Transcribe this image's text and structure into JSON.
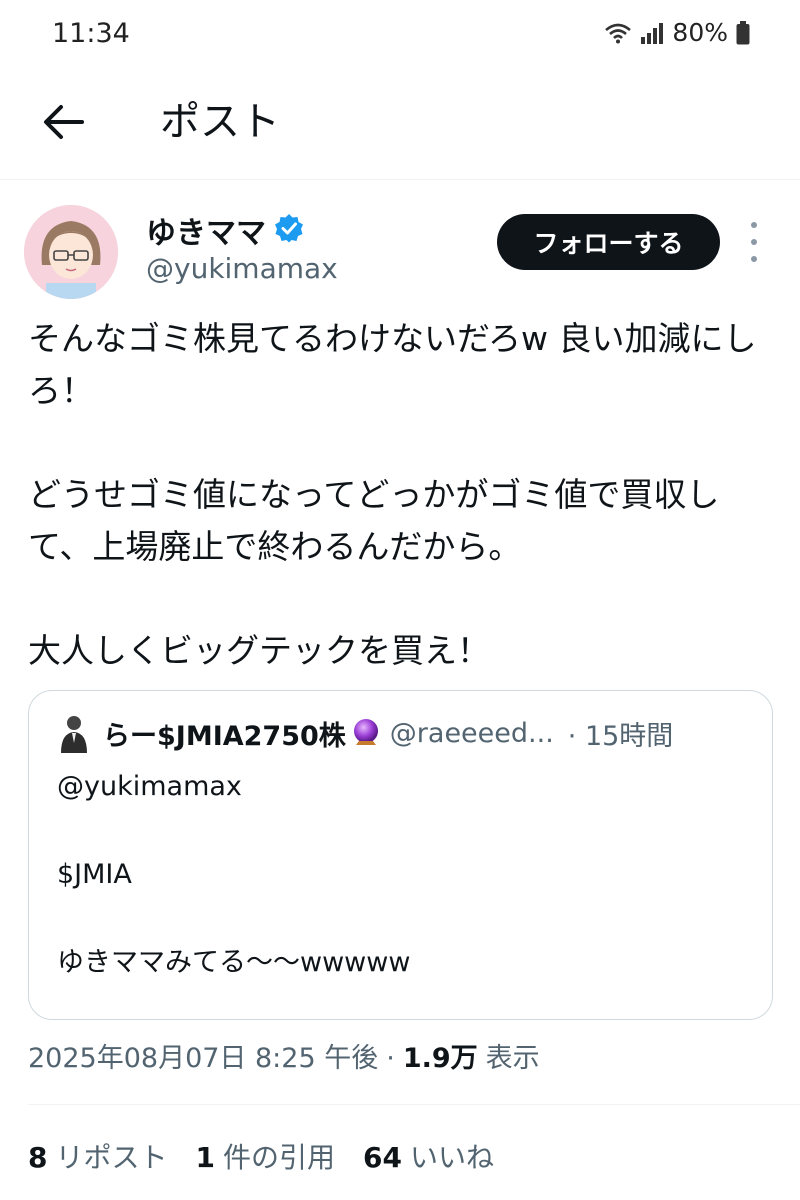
{
  "status_bar": {
    "time": "11:34",
    "battery_percent": "80%",
    "icons": [
      "wifi-icon",
      "signal-icon",
      "battery-icon"
    ]
  },
  "header": {
    "back_icon": "arrow-left-icon",
    "title": "ポスト"
  },
  "post": {
    "author": {
      "display_name": "ゆきママ",
      "handle": "@yukimamax",
      "verified": true
    },
    "follow_label": "フォローする",
    "body": [
      "そんなゴミ株見てるわけないだろw 良い加減にしろ！",
      "どうせゴミ値になってどっかがゴミ値で買収して、上場廃止で終わるんだから。",
      "大人しくビッグテックを買え！"
    ],
    "quote": {
      "author_name": "らー$JMIA2750株",
      "author_handle": "@raeeeed...",
      "time": "· 15時間",
      "body": [
        "@yukimamax",
        "$JMIA",
        "ゆきママみてる〜〜wwwww"
      ]
    },
    "timestamp": "2025年08月07日 8:25 午後",
    "separator": "·",
    "views_count": "1.9万",
    "views_label": "表示",
    "stats": {
      "reposts_count": "8",
      "reposts_label": "リポスト",
      "quotes_count": "1",
      "quotes_label": "件の引用",
      "likes_count": "64",
      "likes_label": "いいね"
    }
  },
  "colors": {
    "text_primary": "#0f1419",
    "text_secondary": "#536471",
    "verified_blue": "#1d9bf0",
    "follow_button_bg": "#0f1419",
    "border": "#cfd9de"
  }
}
